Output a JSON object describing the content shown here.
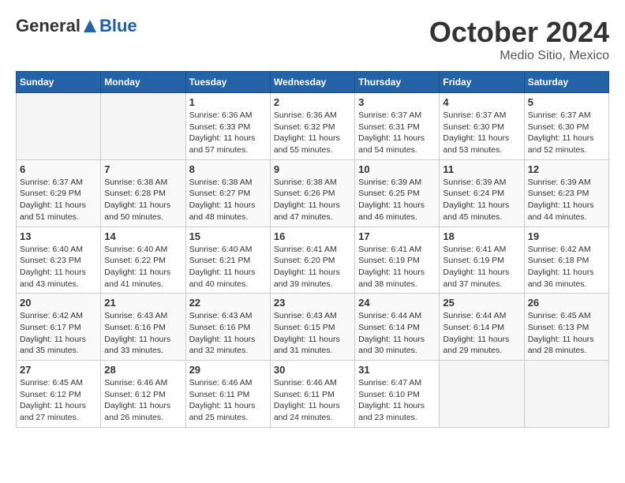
{
  "header": {
    "logo": {
      "general": "General",
      "blue": "Blue"
    },
    "title": "October 2024",
    "location": "Medio Sitio, Mexico"
  },
  "weekdays": [
    "Sunday",
    "Monday",
    "Tuesday",
    "Wednesday",
    "Thursday",
    "Friday",
    "Saturday"
  ],
  "weeks": [
    [
      {
        "day": "",
        "sunrise": "",
        "sunset": "",
        "daylight": ""
      },
      {
        "day": "",
        "sunrise": "",
        "sunset": "",
        "daylight": ""
      },
      {
        "day": "1",
        "sunrise": "Sunrise: 6:36 AM",
        "sunset": "Sunset: 6:33 PM",
        "daylight": "Daylight: 11 hours and 57 minutes."
      },
      {
        "day": "2",
        "sunrise": "Sunrise: 6:36 AM",
        "sunset": "Sunset: 6:32 PM",
        "daylight": "Daylight: 11 hours and 55 minutes."
      },
      {
        "day": "3",
        "sunrise": "Sunrise: 6:37 AM",
        "sunset": "Sunset: 6:31 PM",
        "daylight": "Daylight: 11 hours and 54 minutes."
      },
      {
        "day": "4",
        "sunrise": "Sunrise: 6:37 AM",
        "sunset": "Sunset: 6:30 PM",
        "daylight": "Daylight: 11 hours and 53 minutes."
      },
      {
        "day": "5",
        "sunrise": "Sunrise: 6:37 AM",
        "sunset": "Sunset: 6:30 PM",
        "daylight": "Daylight: 11 hours and 52 minutes."
      }
    ],
    [
      {
        "day": "6",
        "sunrise": "Sunrise: 6:37 AM",
        "sunset": "Sunset: 6:29 PM",
        "daylight": "Daylight: 11 hours and 51 minutes."
      },
      {
        "day": "7",
        "sunrise": "Sunrise: 6:38 AM",
        "sunset": "Sunset: 6:28 PM",
        "daylight": "Daylight: 11 hours and 50 minutes."
      },
      {
        "day": "8",
        "sunrise": "Sunrise: 6:38 AM",
        "sunset": "Sunset: 6:27 PM",
        "daylight": "Daylight: 11 hours and 48 minutes."
      },
      {
        "day": "9",
        "sunrise": "Sunrise: 6:38 AM",
        "sunset": "Sunset: 6:26 PM",
        "daylight": "Daylight: 11 hours and 47 minutes."
      },
      {
        "day": "10",
        "sunrise": "Sunrise: 6:39 AM",
        "sunset": "Sunset: 6:25 PM",
        "daylight": "Daylight: 11 hours and 46 minutes."
      },
      {
        "day": "11",
        "sunrise": "Sunrise: 6:39 AM",
        "sunset": "Sunset: 6:24 PM",
        "daylight": "Daylight: 11 hours and 45 minutes."
      },
      {
        "day": "12",
        "sunrise": "Sunrise: 6:39 AM",
        "sunset": "Sunset: 6:23 PM",
        "daylight": "Daylight: 11 hours and 44 minutes."
      }
    ],
    [
      {
        "day": "13",
        "sunrise": "Sunrise: 6:40 AM",
        "sunset": "Sunset: 6:23 PM",
        "daylight": "Daylight: 11 hours and 43 minutes."
      },
      {
        "day": "14",
        "sunrise": "Sunrise: 6:40 AM",
        "sunset": "Sunset: 6:22 PM",
        "daylight": "Daylight: 11 hours and 41 minutes."
      },
      {
        "day": "15",
        "sunrise": "Sunrise: 6:40 AM",
        "sunset": "Sunset: 6:21 PM",
        "daylight": "Daylight: 11 hours and 40 minutes."
      },
      {
        "day": "16",
        "sunrise": "Sunrise: 6:41 AM",
        "sunset": "Sunset: 6:20 PM",
        "daylight": "Daylight: 11 hours and 39 minutes."
      },
      {
        "day": "17",
        "sunrise": "Sunrise: 6:41 AM",
        "sunset": "Sunset: 6:19 PM",
        "daylight": "Daylight: 11 hours and 38 minutes."
      },
      {
        "day": "18",
        "sunrise": "Sunrise: 6:41 AM",
        "sunset": "Sunset: 6:19 PM",
        "daylight": "Daylight: 11 hours and 37 minutes."
      },
      {
        "day": "19",
        "sunrise": "Sunrise: 6:42 AM",
        "sunset": "Sunset: 6:18 PM",
        "daylight": "Daylight: 11 hours and 36 minutes."
      }
    ],
    [
      {
        "day": "20",
        "sunrise": "Sunrise: 6:42 AM",
        "sunset": "Sunset: 6:17 PM",
        "daylight": "Daylight: 11 hours and 35 minutes."
      },
      {
        "day": "21",
        "sunrise": "Sunrise: 6:43 AM",
        "sunset": "Sunset: 6:16 PM",
        "daylight": "Daylight: 11 hours and 33 minutes."
      },
      {
        "day": "22",
        "sunrise": "Sunrise: 6:43 AM",
        "sunset": "Sunset: 6:16 PM",
        "daylight": "Daylight: 11 hours and 32 minutes."
      },
      {
        "day": "23",
        "sunrise": "Sunrise: 6:43 AM",
        "sunset": "Sunset: 6:15 PM",
        "daylight": "Daylight: 11 hours and 31 minutes."
      },
      {
        "day": "24",
        "sunrise": "Sunrise: 6:44 AM",
        "sunset": "Sunset: 6:14 PM",
        "daylight": "Daylight: 11 hours and 30 minutes."
      },
      {
        "day": "25",
        "sunrise": "Sunrise: 6:44 AM",
        "sunset": "Sunset: 6:14 PM",
        "daylight": "Daylight: 11 hours and 29 minutes."
      },
      {
        "day": "26",
        "sunrise": "Sunrise: 6:45 AM",
        "sunset": "Sunset: 6:13 PM",
        "daylight": "Daylight: 11 hours and 28 minutes."
      }
    ],
    [
      {
        "day": "27",
        "sunrise": "Sunrise: 6:45 AM",
        "sunset": "Sunset: 6:12 PM",
        "daylight": "Daylight: 11 hours and 27 minutes."
      },
      {
        "day": "28",
        "sunrise": "Sunrise: 6:46 AM",
        "sunset": "Sunset: 6:12 PM",
        "daylight": "Daylight: 11 hours and 26 minutes."
      },
      {
        "day": "29",
        "sunrise": "Sunrise: 6:46 AM",
        "sunset": "Sunset: 6:11 PM",
        "daylight": "Daylight: 11 hours and 25 minutes."
      },
      {
        "day": "30",
        "sunrise": "Sunrise: 6:46 AM",
        "sunset": "Sunset: 6:11 PM",
        "daylight": "Daylight: 11 hours and 24 minutes."
      },
      {
        "day": "31",
        "sunrise": "Sunrise: 6:47 AM",
        "sunset": "Sunset: 6:10 PM",
        "daylight": "Daylight: 11 hours and 23 minutes."
      },
      {
        "day": "",
        "sunrise": "",
        "sunset": "",
        "daylight": ""
      },
      {
        "day": "",
        "sunrise": "",
        "sunset": "",
        "daylight": ""
      }
    ]
  ]
}
